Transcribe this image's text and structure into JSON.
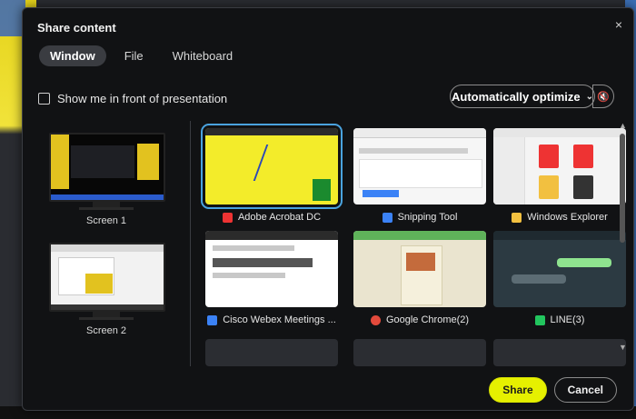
{
  "dialog": {
    "title": "Share content",
    "close_icon": "×"
  },
  "tabs": [
    "Window",
    "File",
    "Whiteboard"
  ],
  "checkbox_label": "Show me in front of presentation",
  "optimize_label": "Automatically optimize",
  "screens": [
    "Screen 1",
    "Screen 2"
  ],
  "windows": [
    {
      "label": "Adobe Acrobat DC",
      "icon": "acrobat-icon",
      "color": "#e33"
    },
    {
      "label": "Snipping Tool",
      "icon": "snipping-tool-icon",
      "color": "#3b82f6"
    },
    {
      "label": "Windows Explorer",
      "icon": "folder-icon",
      "color": "#f2c040"
    },
    {
      "label": "Cisco Webex Meetings ...",
      "icon": "webex-icon",
      "color": "#3b82f6"
    },
    {
      "label": "Google Chrome(2)",
      "icon": "chrome-icon",
      "color": "#e34a3c"
    },
    {
      "label": "LINE(3)",
      "icon": "line-icon",
      "color": "#22c55e"
    }
  ],
  "buttons": {
    "share": "Share",
    "cancel": "Cancel"
  },
  "colors": {
    "accent": "#4aa3df",
    "share": "#e6f000"
  }
}
